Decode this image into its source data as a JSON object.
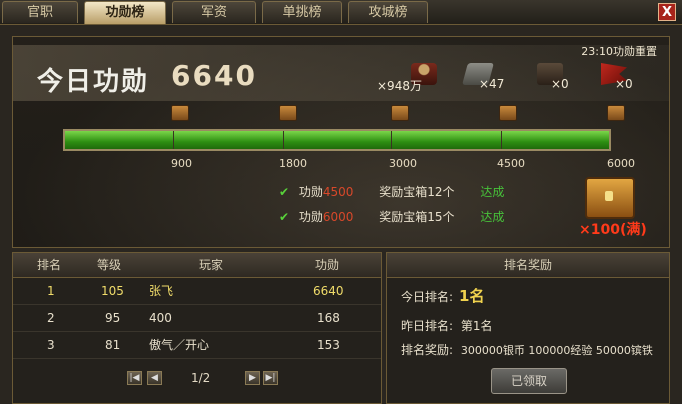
{
  "tabs": [
    "官职",
    "功勋榜",
    "军资",
    "单挑榜",
    "攻城榜"
  ],
  "active_tab": "功勋榜",
  "close_label": "X",
  "summary": {
    "today_label": "今日功勋",
    "today_value": "6640",
    "reset_time": "23:10功勋重置"
  },
  "rewards": [
    {
      "icon": "soldier-icon",
      "count": "×948万"
    },
    {
      "icon": "tank-icon",
      "count": "×47"
    },
    {
      "icon": "cannon-icon",
      "count": "×0"
    },
    {
      "icon": "flag-icon",
      "count": "×0"
    }
  ],
  "progress": {
    "value": 6640,
    "max": 6000,
    "fill_fraction": 1.0,
    "ticks": [
      "900",
      "1800",
      "3000",
      "4500",
      "6000"
    ]
  },
  "tasks": [
    {
      "merit_label": "功勋",
      "merit_value": "4500",
      "reward": "奖励宝箱12个",
      "status": "达成"
    },
    {
      "merit_label": "功勋",
      "merit_value": "6000",
      "reward": "奖励宝箱15个",
      "status": "达成"
    }
  ],
  "chest_total": "×100(满)",
  "ranking": {
    "headers": [
      "排名",
      "等级",
      "玩家",
      "功勋"
    ],
    "rows": [
      {
        "rank": "1",
        "level": "105",
        "player": "张飞",
        "merit": "6640"
      },
      {
        "rank": "2",
        "level": "95",
        "player": "400",
        "merit": "168"
      },
      {
        "rank": "3",
        "level": "81",
        "player": "傲气／开心",
        "merit": "153"
      }
    ],
    "page": "1/2"
  },
  "rank_reward": {
    "title": "排名奖励",
    "today_rank_label": "今日排名:",
    "today_rank_value": "1名",
    "yesterday_rank_label": "昨日排名:",
    "yesterday_rank_value": "第1名",
    "reward_label": "排名奖励:",
    "reward_value": "300000银币 100000经验 50000镔铁",
    "claim_label": "已领取"
  },
  "colors": {
    "progress_green": "#4cae28",
    "highlight_yellow": "#f0dc6a",
    "achieved_green": "#47c23a",
    "alert_red": "#ff3a1a"
  }
}
